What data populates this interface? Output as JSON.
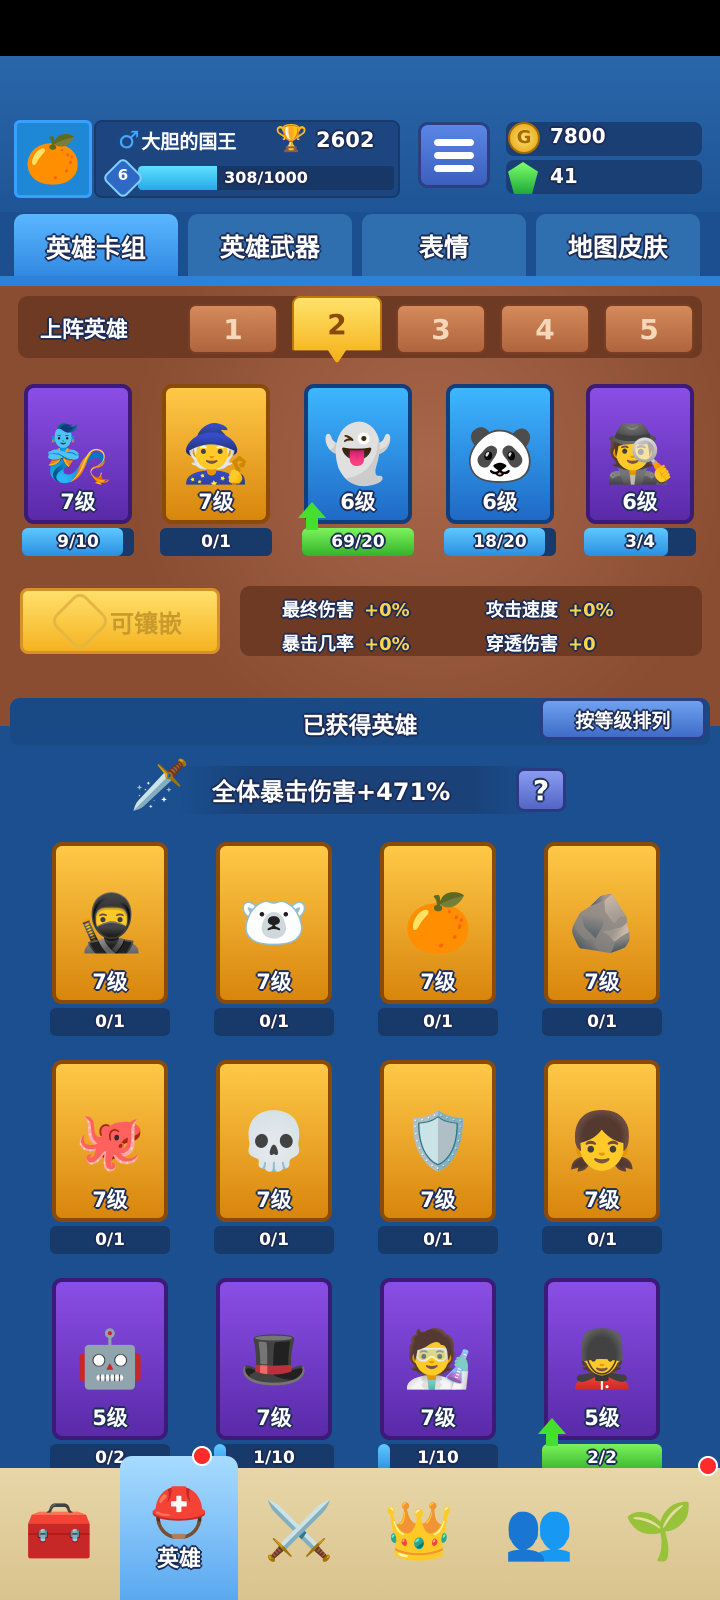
{
  "player": {
    "name": "大胆的国王",
    "gender_icon": "male-icon",
    "trophies": "2602",
    "level": "6",
    "xp_text": "308/1000",
    "xp_progress": 0.308,
    "avatar_icon": "orange-avatar"
  },
  "currency": {
    "gold": "7800",
    "gems": "41"
  },
  "tabs": [
    {
      "label": "英雄卡组",
      "active": true
    },
    {
      "label": "英雄武器",
      "active": false
    },
    {
      "label": "表情",
      "active": false
    },
    {
      "label": "地图皮肤",
      "active": false
    }
  ],
  "deck": {
    "label": "上阵英雄",
    "slots": [
      "1",
      "2",
      "3",
      "4",
      "5"
    ],
    "active_slot": 2,
    "heroes": [
      {
        "emoji": "🧞",
        "color": "purple",
        "level": "7级",
        "count": "9/10",
        "progress": 0.9,
        "bar": "blue",
        "upgrade": false
      },
      {
        "emoji": "🧙",
        "color": "gold",
        "level": "7级",
        "count": "0/1",
        "progress": 0,
        "bar": "none",
        "upgrade": false
      },
      {
        "emoji": "👻",
        "color": "blue",
        "level": "6级",
        "count": "69/20",
        "progress": 1,
        "bar": "green",
        "upgrade": true
      },
      {
        "emoji": "🐼",
        "color": "blue",
        "level": "6级",
        "count": "18/20",
        "progress": 0.9,
        "bar": "blue",
        "upgrade": false
      },
      {
        "emoji": "🕵️",
        "color": "purple",
        "level": "6级",
        "count": "3/4",
        "progress": 0.75,
        "bar": "blue",
        "upgrade": false
      }
    ]
  },
  "inlay": {
    "label": "可镶嵌"
  },
  "stats": [
    {
      "label": "最终伤害",
      "value": "+0%"
    },
    {
      "label": "攻击速度",
      "value": "+0%"
    },
    {
      "label": "暴击几率",
      "value": "+0%"
    },
    {
      "label": "穿透伤害",
      "value": "+0"
    }
  ],
  "collection": {
    "title": "已获得英雄",
    "sort_label": "按等级排列",
    "crit_text": "全体暴击伤害+471%",
    "help_label": "?",
    "heroes": [
      {
        "emoji": "🥷",
        "color": "gold",
        "level": "7级",
        "count": "0/1",
        "progress": 0,
        "bar": "none",
        "upgrade": false
      },
      {
        "emoji": "🐻‍❄️",
        "color": "gold",
        "level": "7级",
        "count": "0/1",
        "progress": 0,
        "bar": "none",
        "upgrade": false
      },
      {
        "emoji": "🍊",
        "color": "gold",
        "level": "7级",
        "count": "0/1",
        "progress": 0,
        "bar": "none",
        "upgrade": false
      },
      {
        "emoji": "🪨",
        "color": "gold",
        "level": "7级",
        "count": "0/1",
        "progress": 0,
        "bar": "none",
        "upgrade": false
      },
      {
        "emoji": "🐙",
        "color": "gold",
        "level": "7级",
        "count": "0/1",
        "progress": 0,
        "bar": "none",
        "upgrade": false
      },
      {
        "emoji": "💀",
        "color": "gold",
        "level": "7级",
        "count": "0/1",
        "progress": 0,
        "bar": "none",
        "upgrade": false
      },
      {
        "emoji": "🛡️",
        "color": "gold",
        "level": "7级",
        "count": "0/1",
        "progress": 0,
        "bar": "none",
        "upgrade": false
      },
      {
        "emoji": "👧",
        "color": "gold",
        "level": "7级",
        "count": "0/1",
        "progress": 0,
        "bar": "none",
        "upgrade": false
      },
      {
        "emoji": "🤖",
        "color": "purple",
        "level": "5级",
        "count": "0/2",
        "progress": 0,
        "bar": "none",
        "upgrade": false
      },
      {
        "emoji": "🎩",
        "color": "purple",
        "level": "7级",
        "count": "1/10",
        "progress": 0.1,
        "bar": "blue",
        "upgrade": false
      },
      {
        "emoji": "🧑‍🔬",
        "color": "purple",
        "level": "7级",
        "count": "1/10",
        "progress": 0.1,
        "bar": "blue",
        "upgrade": false
      },
      {
        "emoji": "💂",
        "color": "purple",
        "level": "5级",
        "count": "2/2",
        "progress": 1,
        "bar": "green",
        "upgrade": true
      }
    ]
  },
  "nav": [
    {
      "icon": "treasure-chest-icon",
      "emoji": "🧰",
      "label": "",
      "active": false,
      "badge": false
    },
    {
      "icon": "knight-helmet-icon",
      "emoji": "⛑️",
      "label": "英雄",
      "active": true,
      "badge": true
    },
    {
      "icon": "crossed-swords-icon",
      "emoji": "⚔️",
      "label": "",
      "active": false,
      "badge": false
    },
    {
      "icon": "crown-shield-icon",
      "emoji": "👑",
      "label": "",
      "active": false,
      "badge": false
    },
    {
      "icon": "friends-icon",
      "emoji": "👥",
      "label": "",
      "active": false,
      "badge": false
    },
    {
      "icon": "sprout-island-icon",
      "emoji": "🌱",
      "label": "",
      "active": false,
      "badge": true
    }
  ]
}
